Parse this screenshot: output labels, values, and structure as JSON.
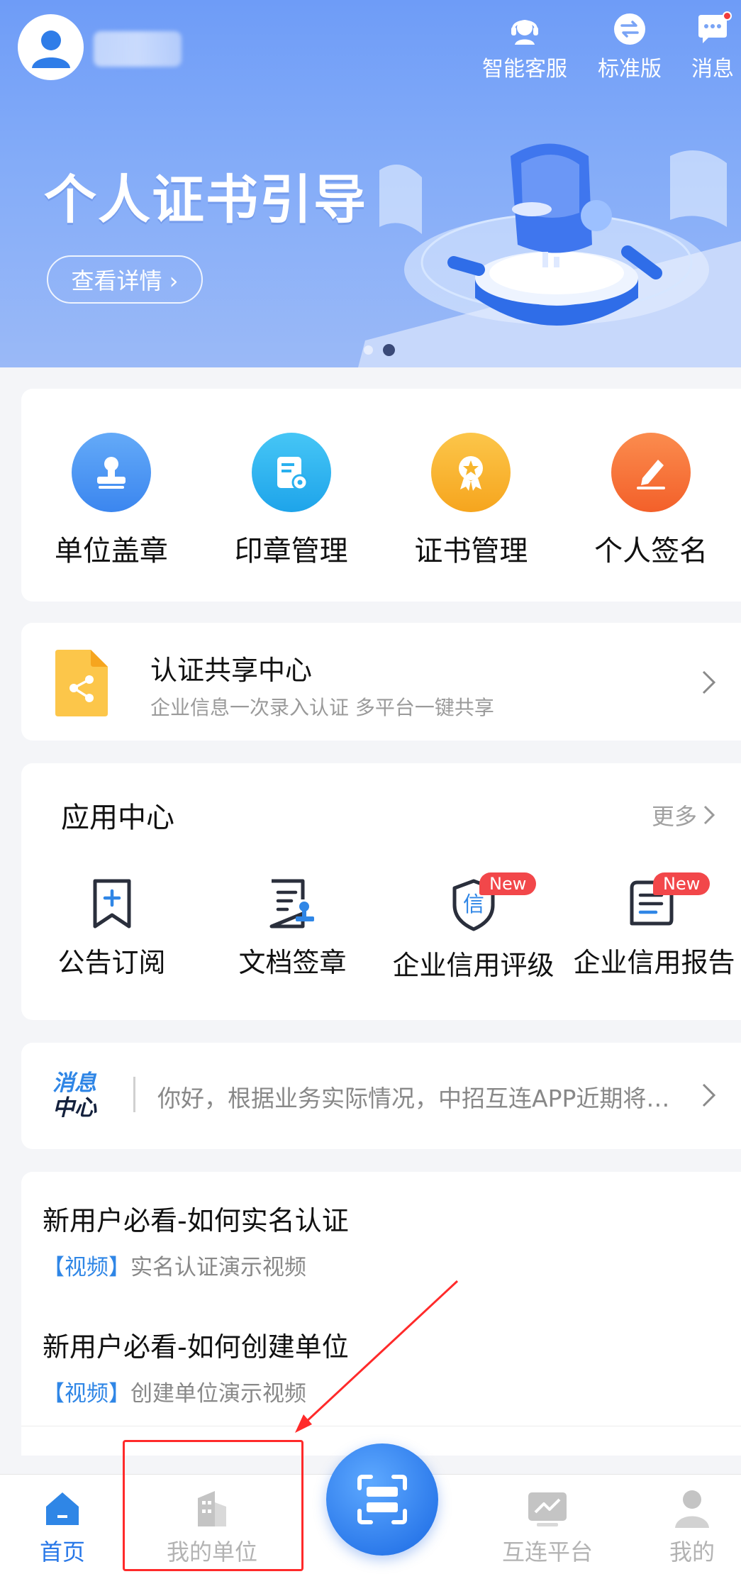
{
  "header": {
    "avatar_icon": "user-avatar-icon",
    "top_actions": [
      {
        "label": "智能客服",
        "icon": "customer-service-icon"
      },
      {
        "label": "标准版",
        "icon": "switch-version-icon"
      },
      {
        "label": "消息",
        "icon": "message-icon",
        "has_unread_dot": true
      }
    ]
  },
  "banner": {
    "title": "个人证书引导",
    "detail_button": "查看详情 ›",
    "slides": 2,
    "active_slide": 2
  },
  "quick_actions": [
    {
      "label": "单位盖章",
      "icon": "stamp-icon",
      "color": "#4e9bf5"
    },
    {
      "label": "印章管理",
      "icon": "seal-manage-icon",
      "color": "#2fb6f0"
    },
    {
      "label": "证书管理",
      "icon": "certificate-icon",
      "color": "#f7b52c"
    },
    {
      "label": "个人签名",
      "icon": "signature-icon",
      "color": "#f6753a"
    }
  ],
  "cert_share": {
    "title": "认证共享中心",
    "subtitle": "企业信息一次录入认证 多平台一键共享",
    "icon": "share-doc-icon"
  },
  "app_center": {
    "title": "应用中心",
    "more": "更多",
    "apps": [
      {
        "label": "公告订阅",
        "icon": "bookmark-plus-icon",
        "badge": ""
      },
      {
        "label": "文档签章",
        "icon": "doc-sign-icon",
        "badge": ""
      },
      {
        "label": "企业信用评级",
        "icon": "credit-shield-icon",
        "badge": "New",
        "shield_text": "信"
      },
      {
        "label": "企业信用报告",
        "icon": "credit-report-icon",
        "badge": "New"
      }
    ]
  },
  "message_center": {
    "logo_line1": "消息",
    "logo_line2": "中心",
    "text": "你好，根据业务实际情况，中招互连APP近期将进行系统升级"
  },
  "guides": [
    {
      "title": "新用户必看-如何实名认证",
      "tag": "【视频】",
      "desc": "实名认证演示视频"
    },
    {
      "title": "新用户必看-如何创建单位",
      "tag": "【视频】",
      "desc": "创建单位演示视频"
    }
  ],
  "tabbar": {
    "tabs": [
      {
        "label": "首页",
        "icon": "home-icon",
        "active": true
      },
      {
        "label": "我的单位",
        "icon": "building-icon",
        "active": false
      },
      {
        "label": "互连平台",
        "icon": "platform-chart-icon",
        "active": false
      },
      {
        "label": "我的",
        "icon": "profile-icon",
        "active": false
      }
    ],
    "center_icon": "scan-icon"
  },
  "colors": {
    "accent": "#2878e8",
    "banner_top": "#6e9cf7",
    "badge_red": "#f2474a",
    "annotation_red": "#ff2a2a"
  }
}
